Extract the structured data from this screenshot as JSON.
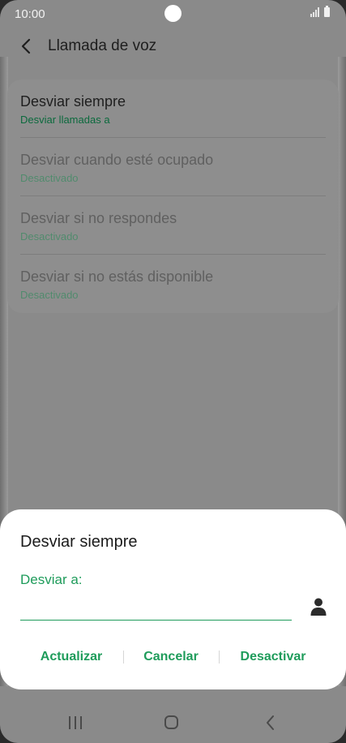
{
  "status_bar": {
    "time": "10:00"
  },
  "app_bar": {
    "title": "Llamada de voz"
  },
  "forward_options": [
    {
      "label": "Desviar siempre",
      "status": "Desviar llamadas a"
    },
    {
      "label": "Desviar cuando esté ocupado",
      "status": "Desactivado"
    },
    {
      "label": "Desviar si no respondes",
      "status": "Desactivado"
    },
    {
      "label": "Desviar si no estás disponible",
      "status": "Desactivado"
    }
  ],
  "dialog": {
    "title": "Desviar siempre",
    "field_label": "Desviar a:",
    "field_value": "",
    "buttons": {
      "update": "Actualizar",
      "cancel": "Cancelar",
      "deactivate": "Desactivar"
    }
  },
  "colors": {
    "accent": "#1f9c5b",
    "scrim": "#8a8a8a",
    "dialog_bg": "#ffffff"
  },
  "icons": {
    "back": "back-arrow-icon",
    "contact": "contact-person-icon",
    "nav_recents": "recents-icon",
    "nav_home": "home-icon",
    "nav_back": "nav-back-icon"
  }
}
